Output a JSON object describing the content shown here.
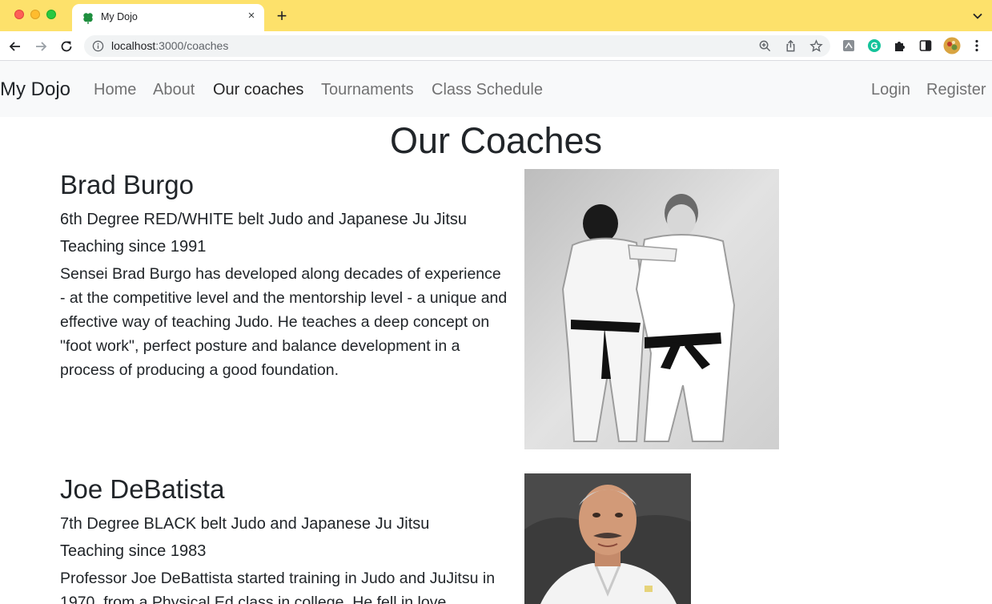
{
  "browser": {
    "tab_title": "My Dojo",
    "close_glyph": "×",
    "new_tab_glyph": "+",
    "url_host": "localhost",
    "url_path": ":3000/coaches"
  },
  "navbar": {
    "brand": "My Dojo",
    "links": [
      "Home",
      "About",
      "Our coaches",
      "Tournaments",
      "Class Schedule"
    ],
    "active": "Our coaches",
    "right_links": [
      "Login",
      "Register"
    ]
  },
  "page": {
    "title": "Our Coaches"
  },
  "coaches": [
    {
      "name": "Brad Burgo",
      "belt": "6th Degree RED/WHITE belt Judo and Japanese Ju Jitsu",
      "since": "Teaching since 1991",
      "bio": "Sensei Brad Burgo has developed along decades of experience - at the competitive level and the mentorship level - a unique and effective way of teaching Judo. He teaches a deep concept on \"foot work\", perfect posture and balance development in a process of producing a good foundation."
    },
    {
      "name": "Joe DeBatista",
      "belt": "7th Degree BLACK belt Judo and Japanese Ju Jitsu",
      "since": "Teaching since 1983",
      "bio": "Professor Joe DeBattista started training in Judo and JuJitsu in 1970, from a Physical Ed class in college. He fell in love"
    }
  ],
  "colors": {
    "tabbar": "#fde16b",
    "navbar_bg": "#f8f9fa",
    "text": "#212529"
  },
  "icons": [
    "clover-favicon-icon",
    "close-icon",
    "plus-icon",
    "chevron-down-icon",
    "back-icon",
    "forward-icon",
    "reload-icon",
    "info-icon",
    "zoom-icon",
    "share-icon",
    "star-icon",
    "extension-icon",
    "grammarly-icon",
    "puzzle-icon",
    "sidepanel-icon",
    "profile-avatar-icon",
    "kebab-menu-icon"
  ]
}
